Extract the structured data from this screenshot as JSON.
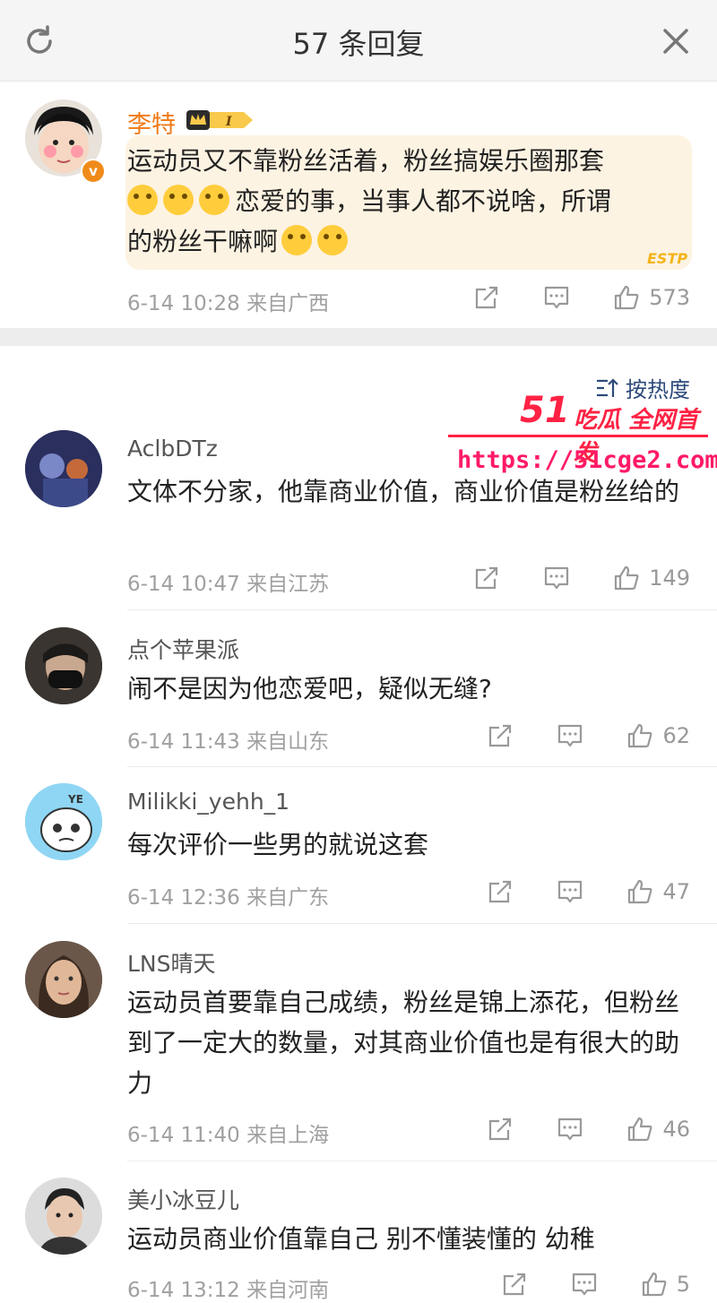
{
  "header": {
    "title": "57 条回复"
  },
  "top_comment": {
    "name": "李特",
    "text_part1": "运动员又不靠粉丝活着，粉丝搞娱乐圈那套",
    "text_part2": "恋爱的事，当事人都不说啥，所谓",
    "text_part3": "的粉丝干嘛啊",
    "time": "6-14 10:28  来自广西",
    "likes": "573",
    "badge": "ESTP"
  },
  "sort_label": "按热度",
  "watermark": {
    "brand": "51",
    "tag": "吃瓜 全网首发",
    "url": "https://51cge2.com"
  },
  "replies": [
    {
      "name": "AclbDTz",
      "text": "文体不分家，他靠商业价值，商业价值是粉丝给的",
      "time": "6-14 10:47  来自江苏",
      "likes": "149"
    },
    {
      "name": "点个苹果派",
      "text": "闹不是因为他恋爱吧，疑似无缝?",
      "time": "6-14 11:43  来自山东",
      "likes": "62"
    },
    {
      "name": "Milikki_yehh_1",
      "text": "每次评价一些男的就说这套",
      "time": "6-14 12:36  来自广东",
      "likes": "47"
    },
    {
      "name": "LNS晴天",
      "text": "运动员首要靠自己成绩，粉丝是锦上添花，但粉丝到了一定大的数量，对其商业价值也是有很大的助力",
      "time": "6-14 11:40  来自上海",
      "likes": "46"
    },
    {
      "name": "美小冰豆儿",
      "text": "运动员商业价值靠自己 别不懂装懂的 幼稚",
      "time": "6-14 13:12  来自河南",
      "likes": "5"
    }
  ]
}
